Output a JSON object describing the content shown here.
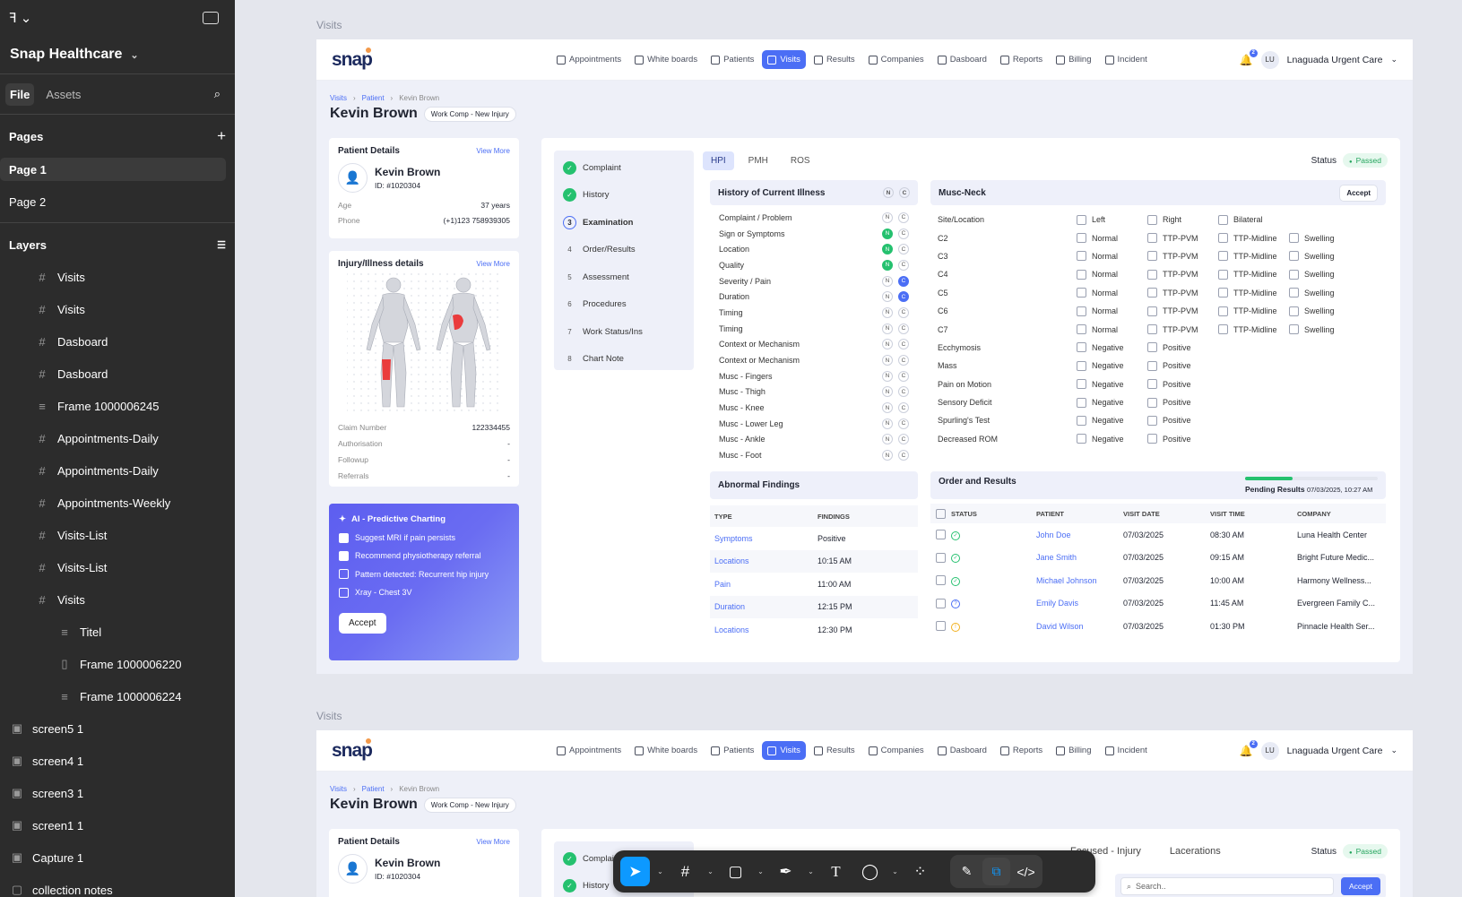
{
  "sidebar": {
    "project": "Snap Healthcare",
    "tabs": [
      "File",
      "Assets"
    ],
    "pages_label": "Pages",
    "pages": [
      "Page 1",
      "Page 2"
    ],
    "layers_label": "Layers",
    "layers": [
      {
        "icon": "#",
        "name": "Visits",
        "indent": 1
      },
      {
        "icon": "#",
        "name": "Visits",
        "indent": 1
      },
      {
        "icon": "#",
        "name": "Dasboard",
        "indent": 1
      },
      {
        "icon": "#",
        "name": "Dasboard",
        "indent": 1
      },
      {
        "icon": "≡",
        "name": "Frame 1000006245",
        "indent": 1
      },
      {
        "icon": "#",
        "name": "Appointments-Daily",
        "indent": 1
      },
      {
        "icon": "#",
        "name": "Appointments-Daily",
        "indent": 1
      },
      {
        "icon": "#",
        "name": "Appointments-Weekly",
        "indent": 1
      },
      {
        "icon": "#",
        "name": "Visits-List",
        "indent": 1
      },
      {
        "icon": "#",
        "name": "Visits-List",
        "indent": 1
      },
      {
        "icon": "#",
        "name": "Visits",
        "indent": 1
      },
      {
        "icon": "≡",
        "name": "Titel",
        "indent": 2
      },
      {
        "icon": "▯",
        "name": "Frame 1000006220",
        "indent": 2
      },
      {
        "icon": "≡",
        "name": "Frame 1000006224",
        "indent": 2
      },
      {
        "icon": "▣",
        "name": "screen5 1",
        "indent": 0
      },
      {
        "icon": "▣",
        "name": "screen4 1",
        "indent": 0
      },
      {
        "icon": "▣",
        "name": "screen3 1",
        "indent": 0
      },
      {
        "icon": "▣",
        "name": "screen1 1",
        "indent": 0
      },
      {
        "icon": "▣",
        "name": "Capture 1",
        "indent": 0
      },
      {
        "icon": "▢",
        "name": "collection notes",
        "indent": 0
      }
    ]
  },
  "frame_label": "Visits",
  "app": {
    "logo": "snap",
    "nav": [
      "Appointments",
      "White boards",
      "Patients",
      "Visits",
      "Results",
      "Companies",
      "Dasboard",
      "Reports",
      "Billing",
      "Incident"
    ],
    "active_nav": "Visits",
    "notif_count": "2",
    "user_initials": "LU",
    "user_org": "Lnaguada Urgent Care",
    "breadcrumb": [
      "Visits",
      "Patient",
      "Kevin Brown"
    ],
    "patient_name": "Kevin Brown",
    "visit_type": "Work Comp - New Injury"
  },
  "patient": {
    "title": "Patient Details",
    "view_more": "View More",
    "name": "Kevin Brown",
    "id": "ID: #1020304",
    "age_label": "Age",
    "age": "37 years",
    "phone_label": "Phone",
    "phone": "(+1)123 758939305"
  },
  "injury": {
    "title": "Injury/Illness details",
    "view_more": "View More",
    "fields": [
      {
        "k": "Claim Number",
        "v": "122334455"
      },
      {
        "k": "Authorisation",
        "v": "-"
      },
      {
        "k": "Followup",
        "v": "-"
      },
      {
        "k": "Referrals",
        "v": "-"
      }
    ]
  },
  "ai": {
    "title": "AI - Predictive Charting",
    "items": [
      {
        "text": "Suggest MRI if pain persists",
        "checked": true
      },
      {
        "text": "Recommend physiotherapy referral",
        "checked": true
      },
      {
        "text": "Pattern detected: Recurrent hip injury",
        "checked": false
      },
      {
        "text": "Xray - Chest 3V",
        "checked": false
      }
    ],
    "accept": "Accept"
  },
  "steps": [
    {
      "n": "✓",
      "label": "Complaint",
      "state": "done"
    },
    {
      "n": "✓",
      "label": "History",
      "state": "done"
    },
    {
      "n": "3",
      "label": "Examination",
      "state": "current"
    },
    {
      "n": "4",
      "label": "Order/Results",
      "state": "todo"
    },
    {
      "n": "5",
      "label": "Assessment",
      "state": "todo"
    },
    {
      "n": "6",
      "label": "Procedures",
      "state": "todo"
    },
    {
      "n": "7",
      "label": "Work Status/Ins",
      "state": "todo"
    },
    {
      "n": "8",
      "label": "Chart Note",
      "state": "todo"
    }
  ],
  "subtabs": [
    "HPI",
    "PMH",
    "ROS"
  ],
  "status_label": "Status",
  "status_value": "Passed",
  "hpi": {
    "title": "History of Current Illness",
    "rows": [
      {
        "label": "Complaint / Problem",
        "n": "",
        "c": ""
      },
      {
        "label": "Sign or Symptoms",
        "n": "g",
        "c": ""
      },
      {
        "label": "Location",
        "n": "g",
        "c": ""
      },
      {
        "label": "Quality",
        "n": "g",
        "c": ""
      },
      {
        "label": "Severity / Pain",
        "n": "",
        "c": "b"
      },
      {
        "label": "Duration",
        "n": "",
        "c": "b"
      },
      {
        "label": "Timing",
        "n": "",
        "c": ""
      },
      {
        "label": "Timing",
        "n": "",
        "c": ""
      },
      {
        "label": "Context or Mechanism",
        "n": "",
        "c": ""
      },
      {
        "label": "Context or Mechanism",
        "n": "",
        "c": ""
      },
      {
        "label": "Musc - Fingers",
        "n": "",
        "c": ""
      },
      {
        "label": "Musc - Thigh",
        "n": "",
        "c": ""
      },
      {
        "label": "Musc - Knee",
        "n": "",
        "c": ""
      },
      {
        "label": "Musc - Lower Leg",
        "n": "",
        "c": ""
      },
      {
        "label": "Musc - Ankle",
        "n": "",
        "c": ""
      },
      {
        "label": "Musc - Foot",
        "n": "",
        "c": ""
      }
    ]
  },
  "musc": {
    "title": "Musc-Neck",
    "accept": "Accept",
    "rows": [
      {
        "label": "Site/Location",
        "opts": [
          "Left",
          "Right",
          "Bilateral"
        ]
      },
      {
        "label": "C2",
        "opts": [
          "Normal",
          "TTP-PVM",
          "TTP-Midline",
          "Swelling"
        ]
      },
      {
        "label": "C3",
        "opts": [
          "Normal",
          "TTP-PVM",
          "TTP-Midline",
          "Swelling"
        ]
      },
      {
        "label": "C4",
        "opts": [
          "Normal",
          "TTP-PVM",
          "TTP-Midline",
          "Swelling"
        ]
      },
      {
        "label": "C5",
        "opts": [
          "Normal",
          "TTP-PVM",
          "TTP-Midline",
          "Swelling"
        ]
      },
      {
        "label": "C6",
        "opts": [
          "Normal",
          "TTP-PVM",
          "TTP-Midline",
          "Swelling"
        ]
      },
      {
        "label": "C7",
        "opts": [
          "Normal",
          "TTP-PVM",
          "TTP-Midline",
          "Swelling"
        ]
      },
      {
        "label": "Ecchymosis",
        "opts": [
          "Negative",
          "Positive"
        ]
      },
      {
        "label": "Mass",
        "opts": [
          "Negative",
          "Positive"
        ]
      },
      {
        "label": "Pain on Motion",
        "opts": [
          "Negative",
          "Positive"
        ]
      },
      {
        "label": "Sensory Deficit",
        "opts": [
          "Negative",
          "Positive"
        ]
      },
      {
        "label": "Spurling's Test",
        "opts": [
          "Negative",
          "Positive"
        ]
      },
      {
        "label": "Decreased ROM",
        "opts": [
          "Negative",
          "Positive"
        ]
      }
    ]
  },
  "abnormal": {
    "title": "Abnormal Findings",
    "cols": [
      "TYPE",
      "FINDINGS"
    ],
    "rows": [
      {
        "type": "Symptoms",
        "f": "Positive"
      },
      {
        "type": "Locations",
        "f": "10:15 AM"
      },
      {
        "type": "Pain",
        "f": "11:00 AM"
      },
      {
        "type": "Duration",
        "f": "12:15 PM"
      },
      {
        "type": "Locations",
        "f": "12:30 PM"
      }
    ]
  },
  "orders": {
    "title": "Order and Results",
    "pending": "Pending Results",
    "pending_date": "07/03/2025, 10:27 AM",
    "progress": 0.36,
    "cols": [
      "STATUS",
      "PATIENT",
      "VISIT DATE",
      "VISIT TIME",
      "COMPANY"
    ],
    "rows": [
      {
        "s": "ok",
        "p": "John Doe",
        "d": "07/03/2025",
        "t": "08:30 AM",
        "c": "Luna Health Center"
      },
      {
        "s": "ok",
        "p": "Jane Smith",
        "d": "07/03/2025",
        "t": "09:15 AM",
        "c": "Bright Future Medic..."
      },
      {
        "s": "ok",
        "p": "Michael Johnson",
        "d": "07/03/2025",
        "t": "10:00 AM",
        "c": "Harmony Wellness..."
      },
      {
        "s": "q",
        "p": "Emily Davis",
        "d": "07/03/2025",
        "t": "11:45 AM",
        "c": "Evergreen Family C..."
      },
      {
        "s": "w",
        "p": "David Wilson",
        "d": "07/03/2025",
        "t": "01:30 PM",
        "c": "Pinnacle Health Ser..."
      }
    ]
  },
  "frame2": {
    "tabs": [
      "Focused - Injury",
      "Lacerations"
    ],
    "search_placeholder": "Search..",
    "accept": "Accept"
  },
  "colors": {
    "accent": "#4b6ef5",
    "success": "#25c16f",
    "figma_blue": "#0d99ff"
  }
}
